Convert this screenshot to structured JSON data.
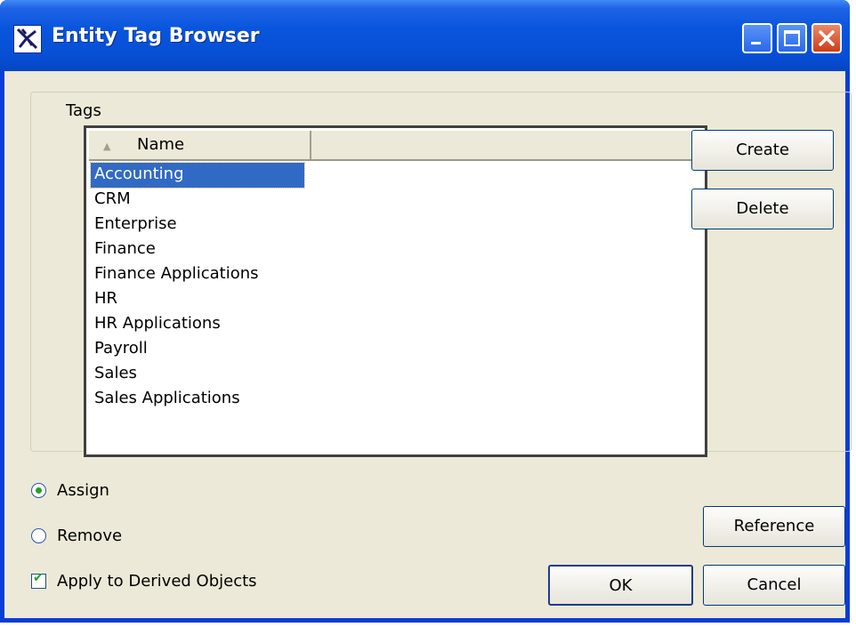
{
  "window": {
    "title": "Entity Tag Browser",
    "controls": [
      "minimize-icon",
      "maximize-icon",
      "close-icon"
    ]
  },
  "tags_group": {
    "label": "Tags",
    "list": {
      "column_header": "Name",
      "sort": "ascending",
      "items": [
        {
          "label": "Accounting",
          "selected": true
        },
        {
          "label": "CRM",
          "selected": false
        },
        {
          "label": "Enterprise",
          "selected": false
        },
        {
          "label": "Finance",
          "selected": false
        },
        {
          "label": "Finance Applications",
          "selected": false
        },
        {
          "label": "HR",
          "selected": false
        },
        {
          "label": "HR Applications",
          "selected": false
        },
        {
          "label": "Payroll",
          "selected": false
        },
        {
          "label": "Sales",
          "selected": false
        },
        {
          "label": "Sales Applications",
          "selected": false
        }
      ]
    }
  },
  "buttons": {
    "create": "Create",
    "delete": "Delete",
    "reference": "Reference",
    "ok": "OK",
    "cancel": "Cancel"
  },
  "options": {
    "assign": {
      "label": "Assign",
      "checked": true
    },
    "remove": {
      "label": "Remove",
      "checked": false
    },
    "apply_derived": {
      "label": "Apply to Derived Objects",
      "checked": true
    }
  },
  "colors": {
    "selection": "#316ac5",
    "titlebar": "#0855dd",
    "dialog_bg": "#ece9d8"
  }
}
